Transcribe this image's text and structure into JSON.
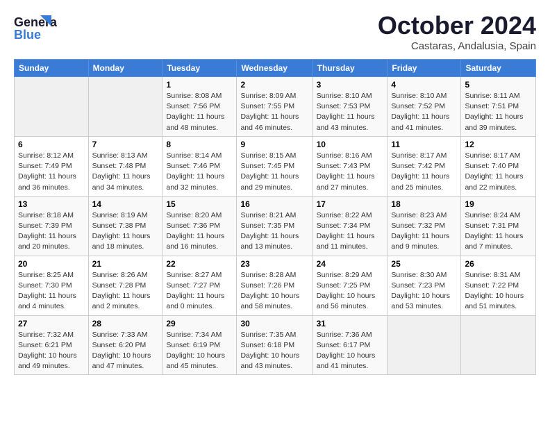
{
  "header": {
    "logo_line1": "General",
    "logo_line2": "Blue",
    "title": "October 2024",
    "location": "Castaras, Andalusia, Spain"
  },
  "weekdays": [
    "Sunday",
    "Monday",
    "Tuesday",
    "Wednesday",
    "Thursday",
    "Friday",
    "Saturday"
  ],
  "weeks": [
    [
      {
        "day": "",
        "sunrise": "",
        "sunset": "",
        "daylight": ""
      },
      {
        "day": "",
        "sunrise": "",
        "sunset": "",
        "daylight": ""
      },
      {
        "day": "1",
        "sunrise": "Sunrise: 8:08 AM",
        "sunset": "Sunset: 7:56 PM",
        "daylight": "Daylight: 11 hours and 48 minutes."
      },
      {
        "day": "2",
        "sunrise": "Sunrise: 8:09 AM",
        "sunset": "Sunset: 7:55 PM",
        "daylight": "Daylight: 11 hours and 46 minutes."
      },
      {
        "day": "3",
        "sunrise": "Sunrise: 8:10 AM",
        "sunset": "Sunset: 7:53 PM",
        "daylight": "Daylight: 11 hours and 43 minutes."
      },
      {
        "day": "4",
        "sunrise": "Sunrise: 8:10 AM",
        "sunset": "Sunset: 7:52 PM",
        "daylight": "Daylight: 11 hours and 41 minutes."
      },
      {
        "day": "5",
        "sunrise": "Sunrise: 8:11 AM",
        "sunset": "Sunset: 7:51 PM",
        "daylight": "Daylight: 11 hours and 39 minutes."
      }
    ],
    [
      {
        "day": "6",
        "sunrise": "Sunrise: 8:12 AM",
        "sunset": "Sunset: 7:49 PM",
        "daylight": "Daylight: 11 hours and 36 minutes."
      },
      {
        "day": "7",
        "sunrise": "Sunrise: 8:13 AM",
        "sunset": "Sunset: 7:48 PM",
        "daylight": "Daylight: 11 hours and 34 minutes."
      },
      {
        "day": "8",
        "sunrise": "Sunrise: 8:14 AM",
        "sunset": "Sunset: 7:46 PM",
        "daylight": "Daylight: 11 hours and 32 minutes."
      },
      {
        "day": "9",
        "sunrise": "Sunrise: 8:15 AM",
        "sunset": "Sunset: 7:45 PM",
        "daylight": "Daylight: 11 hours and 29 minutes."
      },
      {
        "day": "10",
        "sunrise": "Sunrise: 8:16 AM",
        "sunset": "Sunset: 7:43 PM",
        "daylight": "Daylight: 11 hours and 27 minutes."
      },
      {
        "day": "11",
        "sunrise": "Sunrise: 8:17 AM",
        "sunset": "Sunset: 7:42 PM",
        "daylight": "Daylight: 11 hours and 25 minutes."
      },
      {
        "day": "12",
        "sunrise": "Sunrise: 8:17 AM",
        "sunset": "Sunset: 7:40 PM",
        "daylight": "Daylight: 11 hours and 22 minutes."
      }
    ],
    [
      {
        "day": "13",
        "sunrise": "Sunrise: 8:18 AM",
        "sunset": "Sunset: 7:39 PM",
        "daylight": "Daylight: 11 hours and 20 minutes."
      },
      {
        "day": "14",
        "sunrise": "Sunrise: 8:19 AM",
        "sunset": "Sunset: 7:38 PM",
        "daylight": "Daylight: 11 hours and 18 minutes."
      },
      {
        "day": "15",
        "sunrise": "Sunrise: 8:20 AM",
        "sunset": "Sunset: 7:36 PM",
        "daylight": "Daylight: 11 hours and 16 minutes."
      },
      {
        "day": "16",
        "sunrise": "Sunrise: 8:21 AM",
        "sunset": "Sunset: 7:35 PM",
        "daylight": "Daylight: 11 hours and 13 minutes."
      },
      {
        "day": "17",
        "sunrise": "Sunrise: 8:22 AM",
        "sunset": "Sunset: 7:34 PM",
        "daylight": "Daylight: 11 hours and 11 minutes."
      },
      {
        "day": "18",
        "sunrise": "Sunrise: 8:23 AM",
        "sunset": "Sunset: 7:32 PM",
        "daylight": "Daylight: 11 hours and 9 minutes."
      },
      {
        "day": "19",
        "sunrise": "Sunrise: 8:24 AM",
        "sunset": "Sunset: 7:31 PM",
        "daylight": "Daylight: 11 hours and 7 minutes."
      }
    ],
    [
      {
        "day": "20",
        "sunrise": "Sunrise: 8:25 AM",
        "sunset": "Sunset: 7:30 PM",
        "daylight": "Daylight: 11 hours and 4 minutes."
      },
      {
        "day": "21",
        "sunrise": "Sunrise: 8:26 AM",
        "sunset": "Sunset: 7:28 PM",
        "daylight": "Daylight: 11 hours and 2 minutes."
      },
      {
        "day": "22",
        "sunrise": "Sunrise: 8:27 AM",
        "sunset": "Sunset: 7:27 PM",
        "daylight": "Daylight: 11 hours and 0 minutes."
      },
      {
        "day": "23",
        "sunrise": "Sunrise: 8:28 AM",
        "sunset": "Sunset: 7:26 PM",
        "daylight": "Daylight: 10 hours and 58 minutes."
      },
      {
        "day": "24",
        "sunrise": "Sunrise: 8:29 AM",
        "sunset": "Sunset: 7:25 PM",
        "daylight": "Daylight: 10 hours and 56 minutes."
      },
      {
        "day": "25",
        "sunrise": "Sunrise: 8:30 AM",
        "sunset": "Sunset: 7:23 PM",
        "daylight": "Daylight: 10 hours and 53 minutes."
      },
      {
        "day": "26",
        "sunrise": "Sunrise: 8:31 AM",
        "sunset": "Sunset: 7:22 PM",
        "daylight": "Daylight: 10 hours and 51 minutes."
      }
    ],
    [
      {
        "day": "27",
        "sunrise": "Sunrise: 7:32 AM",
        "sunset": "Sunset: 6:21 PM",
        "daylight": "Daylight: 10 hours and 49 minutes."
      },
      {
        "day": "28",
        "sunrise": "Sunrise: 7:33 AM",
        "sunset": "Sunset: 6:20 PM",
        "daylight": "Daylight: 10 hours and 47 minutes."
      },
      {
        "day": "29",
        "sunrise": "Sunrise: 7:34 AM",
        "sunset": "Sunset: 6:19 PM",
        "daylight": "Daylight: 10 hours and 45 minutes."
      },
      {
        "day": "30",
        "sunrise": "Sunrise: 7:35 AM",
        "sunset": "Sunset: 6:18 PM",
        "daylight": "Daylight: 10 hours and 43 minutes."
      },
      {
        "day": "31",
        "sunrise": "Sunrise: 7:36 AM",
        "sunset": "Sunset: 6:17 PM",
        "daylight": "Daylight: 10 hours and 41 minutes."
      },
      {
        "day": "",
        "sunrise": "",
        "sunset": "",
        "daylight": ""
      },
      {
        "day": "",
        "sunrise": "",
        "sunset": "",
        "daylight": ""
      }
    ]
  ]
}
